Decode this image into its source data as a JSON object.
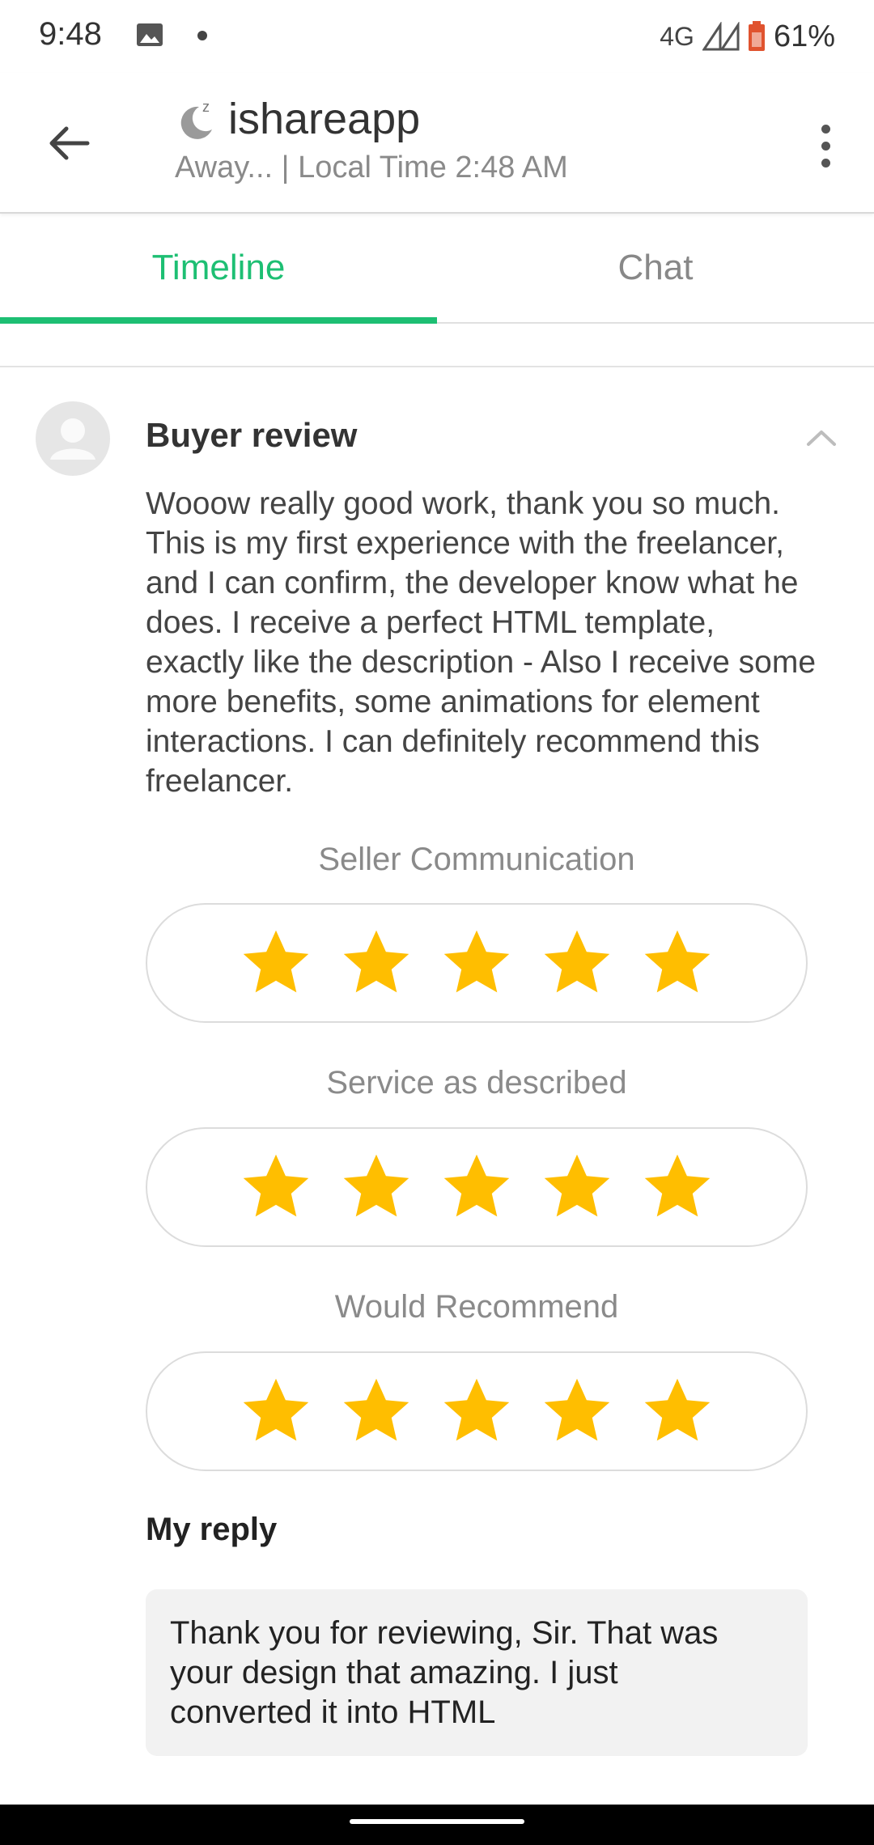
{
  "status_bar": {
    "time": "9:48",
    "network": "4G",
    "battery": "61%"
  },
  "app_bar": {
    "title": "ishareapp",
    "subtitle": "Away... | Local Time 2:48 AM"
  },
  "tabs": [
    {
      "label": "Timeline",
      "active": true
    },
    {
      "label": "Chat",
      "active": false
    }
  ],
  "review": {
    "title": "Buyer review",
    "text": "Wooow really good work, thank you so much. This is my first experience with the freelancer, and I can confirm, the developer know what he does. I receive a perfect HTML template, exactly like the description - Also I receive some more benefits, some animations for element interactions. I can definitely recommend this freelancer.",
    "ratings": [
      {
        "label": "Seller Communication",
        "stars": 5,
        "max": 5
      },
      {
        "label": "Service as described",
        "stars": 5,
        "max": 5
      },
      {
        "label": "Would Recommend",
        "stars": 5,
        "max": 5
      }
    ]
  },
  "reply": {
    "label": "My reply",
    "text": "Thank you for reviewing, Sir. That was your design that amazing. I just converted it into HTML"
  },
  "colors": {
    "accent": "#1dbf73",
    "star": "#ffbe00"
  }
}
